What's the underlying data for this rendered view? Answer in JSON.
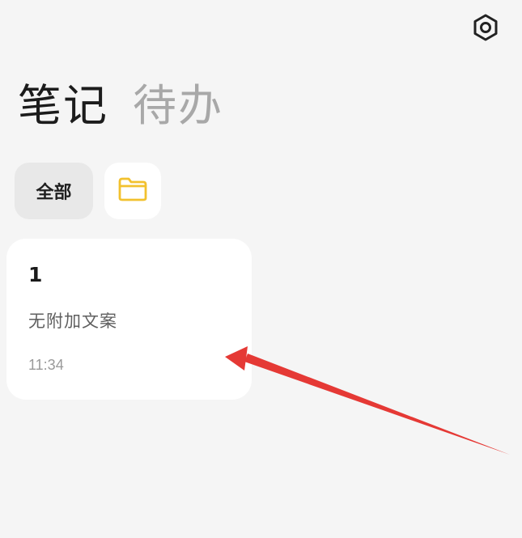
{
  "header": {
    "settings_icon": "gear-icon"
  },
  "tabs": [
    {
      "label": "笔记",
      "active": true
    },
    {
      "label": "待办",
      "active": false
    }
  ],
  "filters": {
    "all_label": "全部",
    "folder_icon": "folder-icon",
    "folder_color": "#f2c12e"
  },
  "notes": [
    {
      "title": "1",
      "body": "无附加文案",
      "time": "11:34"
    }
  ],
  "annotation": {
    "arrow_color": "#e53935"
  }
}
